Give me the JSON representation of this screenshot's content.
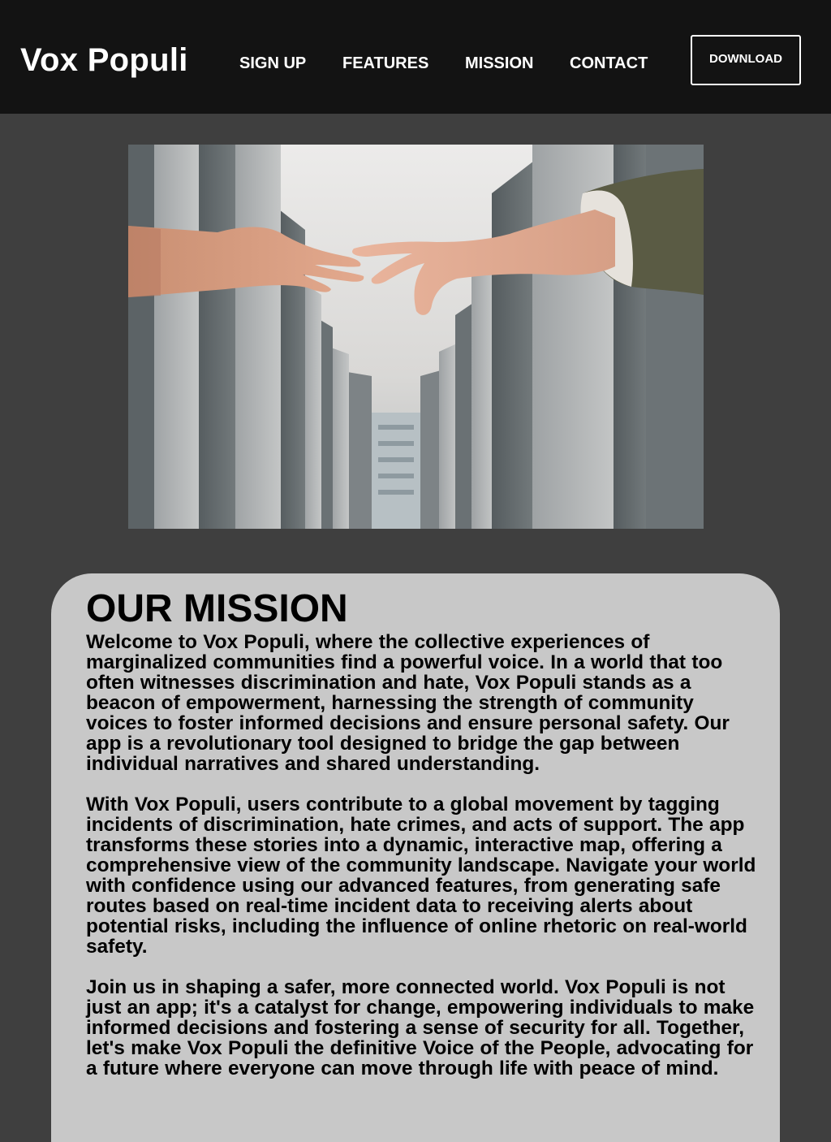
{
  "header": {
    "brand": "Vox Populi",
    "nav": [
      {
        "label": "SIGN UP"
      },
      {
        "label": "FEATURES"
      },
      {
        "label": "MISSION"
      },
      {
        "label": "CONTACT"
      }
    ],
    "download_label": "DOWNLOAD"
  },
  "hero": {
    "image": "two hands reaching toward each other between tall grey concrete pillars"
  },
  "mission": {
    "title": "OUR MISSION",
    "paragraphs": [
      "Welcome to Vox Populi, where the collective experiences of marginalized communities find a powerful voice. In a world that too often witnesses discrimination and hate, Vox Populi stands as a beacon of empowerment, harnessing the strength of community voices to foster informed decisions and ensure personal safety. Our app is a revolutionary tool designed to bridge the gap between individual narratives and shared understanding.",
      "With Vox Populi, users contribute to a global movement by tagging incidents of discrimination, hate crimes, and acts of support. The app transforms these stories into a dynamic, interactive map, offering a comprehensive view of the community landscape. Navigate your world with confidence using our advanced features, from generating safe routes based on real-time incident data to receiving alerts about potential risks, including the influence of online rhetoric on real-world safety.",
      "Join us in shaping a safer, more connected world. Vox Populi is not just an app; it's a catalyst for change, empowering individuals to make informed decisions and fostering a sense of security for all. Together, let's make Vox Populi the definitive Voice of the People, advocating for a future where everyone can move through life with peace of mind."
    ]
  },
  "colors": {
    "navbar": "#131313",
    "page_background": "#3f3f3f",
    "card_background": "#c8c8c8",
    "text_light": "#ffffff",
    "text_dark": "#000000"
  }
}
